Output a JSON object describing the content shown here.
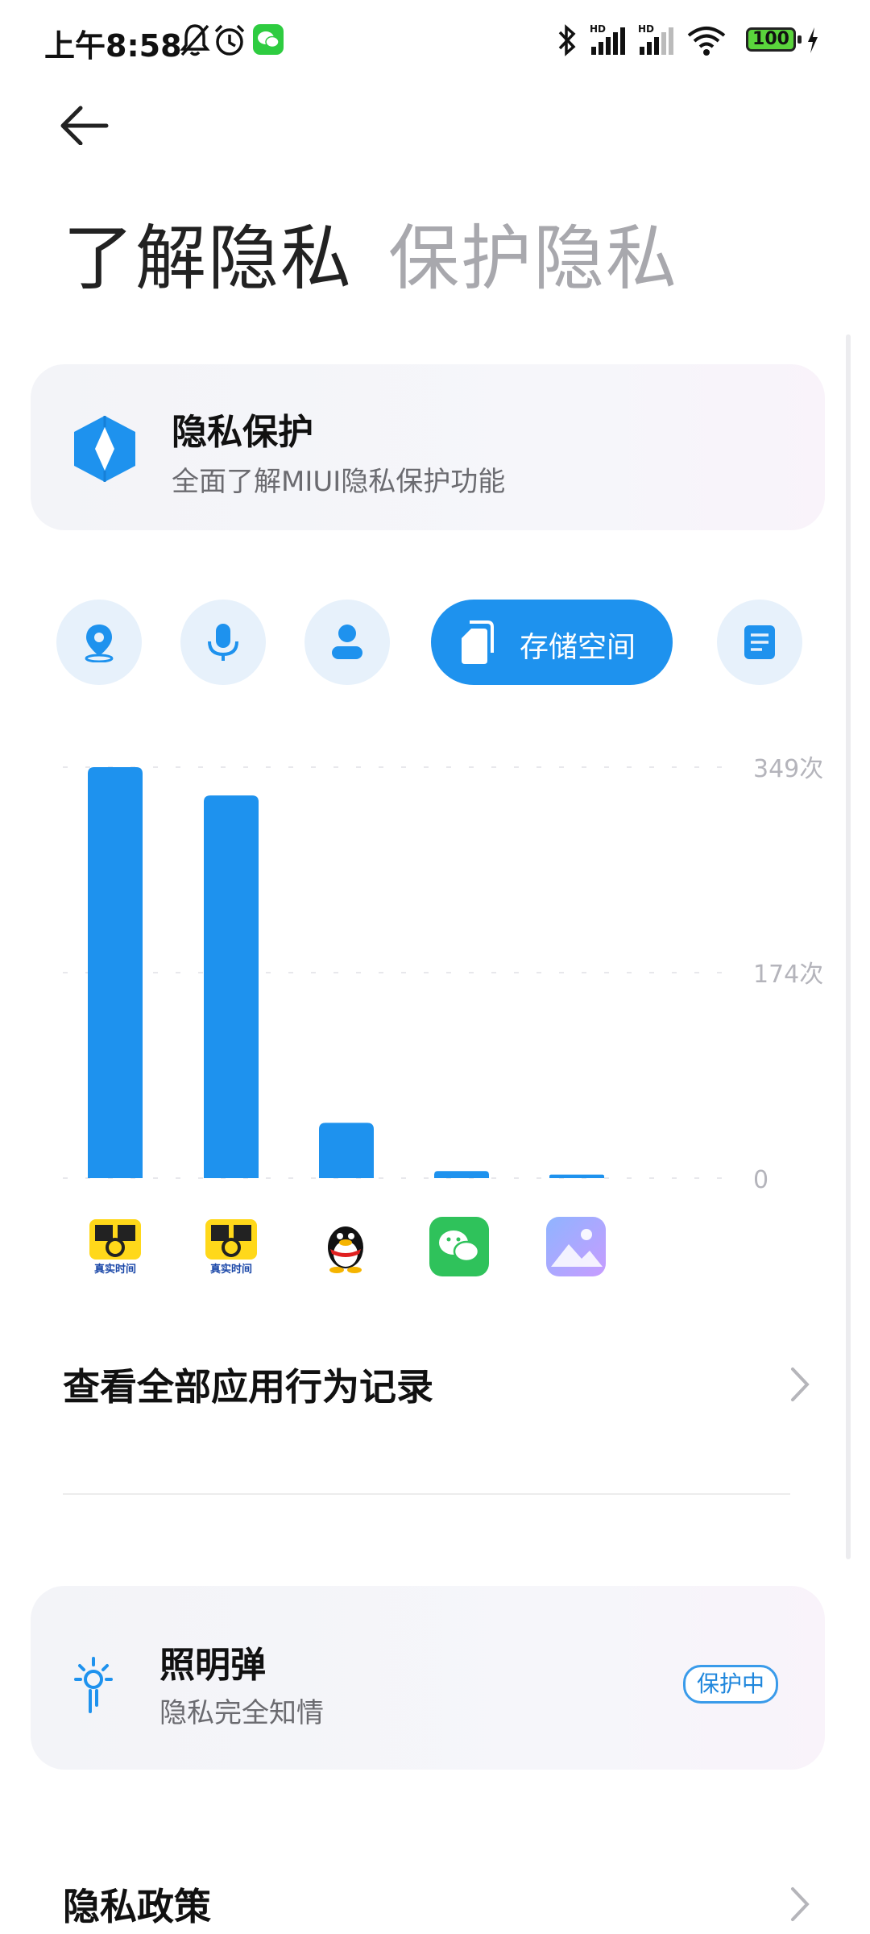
{
  "status_bar": {
    "time": "上午8:58",
    "battery": "100",
    "icons": [
      "mute-bell-icon",
      "alarm-icon",
      "wechat-notification-icon",
      "bluetooth-icon",
      "signal-hd-icon",
      "signal-hd-icon",
      "wifi-icon",
      "battery-icon",
      "charging-icon"
    ]
  },
  "header": {
    "back_icon": "back-arrow-icon",
    "title_primary": "了解隐私",
    "title_secondary": "保护隐私"
  },
  "privacy_card": {
    "title": "隐私保护",
    "subtitle": "全面了解MIUI隐私保护功能",
    "icon": "shield-icon"
  },
  "categories": [
    {
      "id": "location",
      "icon": "location-icon"
    },
    {
      "id": "microphone",
      "icon": "microphone-icon"
    },
    {
      "id": "contacts",
      "icon": "contacts-icon"
    },
    {
      "id": "storage",
      "icon": "storage-icon",
      "label": "存储空间",
      "active": true
    },
    {
      "id": "sms",
      "icon": "message-icon"
    }
  ],
  "chart_data": {
    "type": "bar",
    "categories": [
      "app-1",
      "app-2",
      "app-3",
      "app-4",
      "app-5"
    ],
    "values": [
      349,
      325,
      47,
      6,
      3
    ],
    "tick_labels": [
      "349次",
      "174次",
      "0"
    ],
    "ylim": [
      0,
      349
    ],
    "grid": true,
    "color": "#1e92ee"
  },
  "apps": [
    {
      "icon": "jinri-camera-icon",
      "caption": "真实时间",
      "bg": "#ffd81a"
    },
    {
      "icon": "jinri-camera-icon",
      "caption": "真实时间",
      "bg": "#ffd81a"
    },
    {
      "icon": "qq-penguin-icon"
    },
    {
      "icon": "wechat-icon",
      "bg": "#2fc25b"
    },
    {
      "icon": "gallery-icon"
    }
  ],
  "links": {
    "all_records": "查看全部应用行为记录",
    "privacy_policy": "隐私政策"
  },
  "flare_card": {
    "title": "照明弹",
    "subtitle": "隐私完全知情",
    "badge": "保护中",
    "icon": "flare-light-icon"
  },
  "colors": {
    "accent": "#1e92ee",
    "muted_text": "#6b6b70",
    "title_secondary": "#a8a8ad"
  }
}
